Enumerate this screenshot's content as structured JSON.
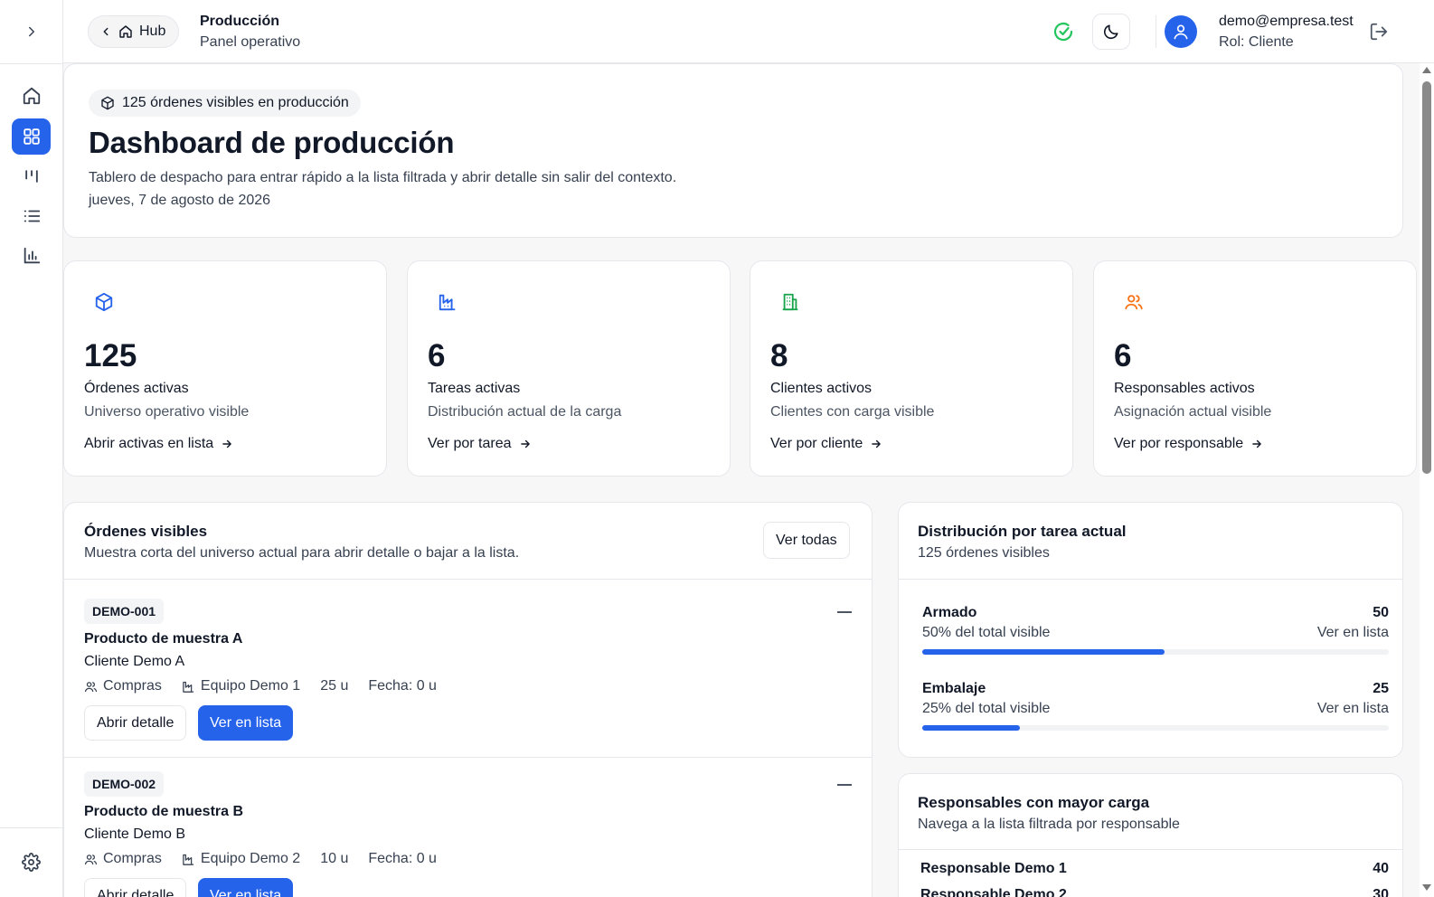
{
  "header": {
    "hub_label": "Hub",
    "title": "Producción",
    "subtitle": "Panel operativo",
    "user_email": "demo@empresa.test",
    "user_role": "Rol: Cliente"
  },
  "sidebar": {
    "items": [
      {
        "name": "home",
        "icon": "home-icon"
      },
      {
        "name": "dashboard",
        "icon": "grid-icon",
        "active": true
      },
      {
        "name": "kanban",
        "icon": "kanban-icon"
      },
      {
        "name": "list",
        "icon": "list-icon"
      },
      {
        "name": "chart",
        "icon": "bar-chart-icon"
      }
    ],
    "settings_icon": "gear-icon"
  },
  "hero": {
    "badge": "125 órdenes visibles en producción",
    "title": "Dashboard de producción",
    "description": "Tablero de despacho para entrar rápido a la lista filtrada y abrir detalle sin salir del contexto.",
    "date": "jueves, 7 de agosto de 2026"
  },
  "stats": [
    {
      "value": "125",
      "label": "Órdenes activas",
      "desc": "Universo operativo visible",
      "link": "Abrir activas en lista",
      "icon": "box-icon",
      "color": "#2563eb"
    },
    {
      "value": "6",
      "label": "Tareas activas",
      "desc": "Distribución actual de la carga",
      "link": "Ver por tarea",
      "icon": "factory-icon",
      "color": "#2563eb"
    },
    {
      "value": "8",
      "label": "Clientes activos",
      "desc": "Clientes con carga visible",
      "link": "Ver por cliente",
      "icon": "building-icon",
      "color": "#16a34a"
    },
    {
      "value": "6",
      "label": "Responsables activos",
      "desc": "Asignación actual visible",
      "link": "Ver por responsable",
      "icon": "users-icon",
      "color": "#f97316"
    }
  ],
  "orders": {
    "title": "Órdenes visibles",
    "subtitle": "Muestra corta del universo actual para abrir detalle o bajar a la lista.",
    "ver_todas": "Ver todas",
    "items": [
      {
        "code": "DEMO-001",
        "product": "Producto de muestra A",
        "client": "Cliente Demo A",
        "area": "Compras",
        "team": "Equipo Demo 1",
        "qty": "25 u",
        "date": "Fecha: 0 u",
        "btn_detail": "Abrir detalle",
        "btn_list": "Ver en lista"
      },
      {
        "code": "DEMO-002",
        "product": "Producto de muestra B",
        "client": "Cliente Demo B",
        "area": "Compras",
        "team": "Equipo Demo 2",
        "qty": "10 u",
        "date": "Fecha: 0 u",
        "btn_detail": "Abrir detalle",
        "btn_list": "Ver en lista"
      }
    ]
  },
  "distribution": {
    "title": "Distribución por tarea actual",
    "subtitle": "125 órdenes visibles",
    "rows": [
      {
        "name": "Armado",
        "count": "50",
        "pct_label": "50% del total visible",
        "link": "Ver en lista",
        "fraction": 0.52
      },
      {
        "name": "Embalaje",
        "count": "25",
        "pct_label": "25% del total visible",
        "link": "Ver en lista",
        "fraction": 0.21
      }
    ]
  },
  "responsables": {
    "title": "Responsables con mayor carga",
    "subtitle": "Navega a la lista filtrada por responsable",
    "rows": [
      {
        "name": "Responsable Demo 1",
        "count": "40"
      },
      {
        "name": "Responsable Demo 2",
        "count": "30"
      }
    ]
  },
  "colors": {
    "accent": "#2563eb",
    "success": "#22c55e"
  }
}
